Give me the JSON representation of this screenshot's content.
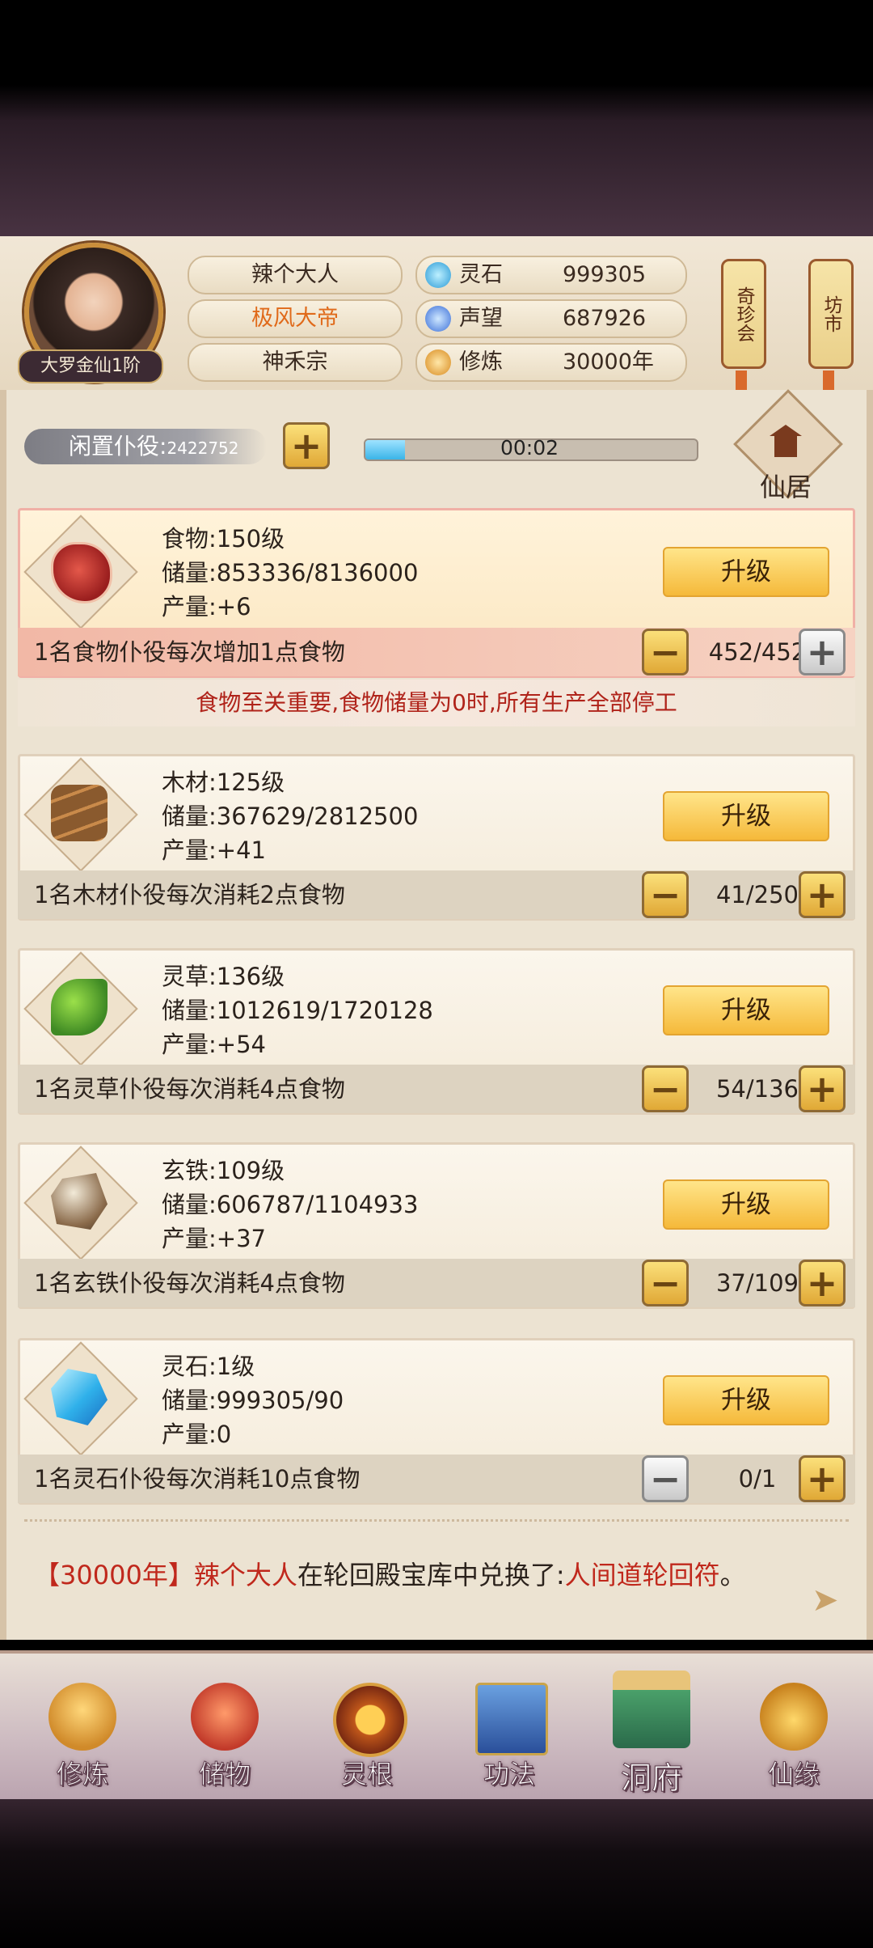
{
  "player": {
    "rank": "大罗金仙1阶",
    "name": "辣个大人",
    "title": "极风大帝",
    "sect": "神禾宗"
  },
  "resources": [
    {
      "label": "灵石",
      "value": "999305",
      "icon": "spirit-stone-icon"
    },
    {
      "label": "声望",
      "value": "687926",
      "icon": "prestige-icon"
    },
    {
      "label": "修炼",
      "value": "30000年",
      "icon": "meditation-icon"
    }
  ],
  "side_buttons": {
    "treasure": "奇珍会",
    "market": "坊市"
  },
  "idle": {
    "label": "闲置仆役:",
    "count": "2422752"
  },
  "timer": {
    "text": "00:02",
    "progress": 0.12
  },
  "xianju": {
    "label": "仙居"
  },
  "upgrade_label": "升级",
  "resource_cards": [
    {
      "name": "食物:150级",
      "storage": "储量:853336/8136000",
      "output": "产量:+6",
      "desc": "1名食物仆役每次增加1点食物",
      "count": "452/452",
      "icon": "meat-icon"
    },
    {
      "name": "木材:125级",
      "storage": "储量:367629/2812500",
      "output": "产量:+41",
      "desc": "1名木材仆役每次消耗2点食物",
      "count": "41/250",
      "icon": "wood-icon"
    },
    {
      "name": "灵草:136级",
      "storage": "储量:1012619/1720128",
      "output": "产量:+54",
      "desc": "1名灵草仆役每次消耗4点食物",
      "count": "54/136",
      "icon": "herb-icon"
    },
    {
      "name": "玄铁:109级",
      "storage": "储量:606787/1104933",
      "output": "产量:+37",
      "desc": "1名玄铁仆役每次消耗4点食物",
      "count": "37/109",
      "icon": "ore-icon"
    },
    {
      "name": "灵石:1级",
      "storage": "储量:999305/90",
      "output": "产量:0",
      "desc": "1名灵石仆役每次消耗10点食物",
      "count": "0/1",
      "icon": "crystal-icon"
    }
  ],
  "notice": "食物至关重要,食物储量为0时,所有生产全部停工",
  "log": {
    "open": "【",
    "year": "30000年",
    "close": "】",
    "player": "辣个大人",
    "middle": "在轮回殿宝库中兑换了:",
    "item": "人间道轮回符",
    "end": "。"
  },
  "nav": [
    {
      "label": "修炼",
      "icon": "cultivate-icon"
    },
    {
      "label": "储物",
      "icon": "storage-bag-icon"
    },
    {
      "label": "灵根",
      "icon": "spirit-root-icon"
    },
    {
      "label": "功法",
      "icon": "skill-book-icon"
    },
    {
      "label": "洞府",
      "icon": "cave-mansion-icon"
    },
    {
      "label": "仙缘",
      "icon": "fate-gourd-icon"
    }
  ],
  "colors": {
    "accent_red": "#c0281c",
    "gold": "#f5b93a",
    "progress_blue": "#3ab4e8"
  }
}
